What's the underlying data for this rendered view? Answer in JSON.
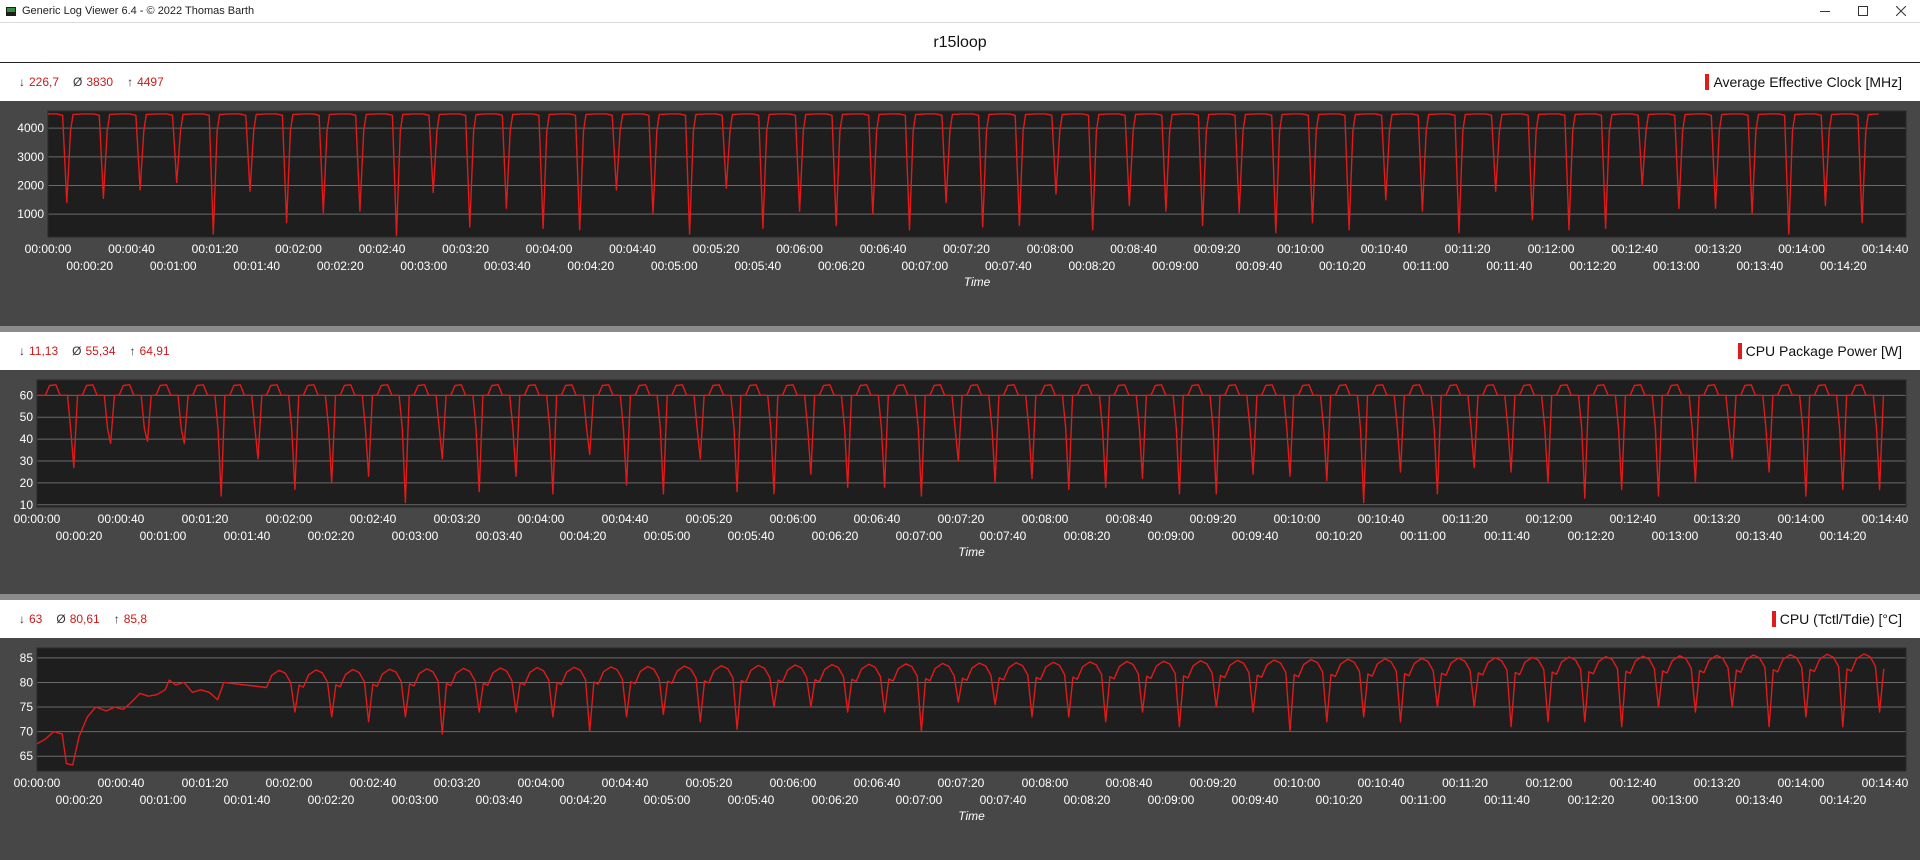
{
  "window": {
    "title": "Generic Log Viewer 6.4 - © 2022 Thomas Barth",
    "icons": [
      "app-icon",
      "minimize-icon",
      "maximize-icon",
      "close-icon"
    ]
  },
  "main_title": "r15loop",
  "colors": {
    "series": "#e11a1a",
    "plot_bg": "#1e1e1e",
    "panel_bg": "#474747",
    "grid": "#6a6a6a",
    "stat_text": "#cc1a1a",
    "axis_text": "#ffffff"
  },
  "time_axis": {
    "label": "Time",
    "top_ticks": [
      "00:00:00",
      "00:00:40",
      "00:01:20",
      "00:02:00",
      "00:02:40",
      "00:03:20",
      "00:04:00",
      "00:04:40",
      "00:05:20",
      "00:06:00",
      "00:06:40",
      "00:07:20",
      "00:08:00",
      "00:08:40",
      "00:09:20",
      "00:10:00",
      "00:10:40",
      "00:11:20",
      "00:12:00",
      "00:12:40",
      "00:13:20",
      "00:14:00",
      "00:14:40"
    ],
    "bottom_ticks": [
      "00:00:20",
      "00:01:00",
      "00:01:40",
      "00:02:20",
      "00:03:00",
      "00:03:40",
      "00:04:20",
      "00:05:00",
      "00:05:40",
      "00:06:20",
      "00:07:00",
      "00:07:40",
      "00:08:20",
      "00:09:00",
      "00:09:40",
      "00:10:20",
      "00:11:00",
      "00:11:40",
      "00:12:20",
      "00:13:00",
      "00:13:40",
      "00:14:20"
    ]
  },
  "panels": [
    {
      "label": "Average Effective Clock [MHz]",
      "stats": {
        "min": "226,7",
        "avg": "3830",
        "max": "4497"
      },
      "stat_symbols": {
        "min": "↓",
        "avg": "Ø",
        "max": "↑"
      }
    },
    {
      "label": "CPU Package Power [W]",
      "stats": {
        "min": "11,13",
        "avg": "55,34",
        "max": "64,91"
      },
      "stat_symbols": {
        "min": "↓",
        "avg": "Ø",
        "max": "↑"
      }
    },
    {
      "label": "CPU (Tctl/Tdie) [°C]",
      "stats": {
        "min": "63",
        "avg": "80,61",
        "max": "85,8"
      },
      "stat_symbols": {
        "min": "↓",
        "avg": "Ø",
        "max": "↑"
      }
    }
  ],
  "chart_data": [
    {
      "type": "line",
      "title": "Average Effective Clock [MHz]",
      "xlabel": "Time",
      "ylabel": "",
      "x_range_seconds": [
        0,
        890
      ],
      "ylim": [
        200,
        4600
      ],
      "yticks": [
        1000,
        2000,
        3000,
        4000
      ],
      "grid": true,
      "cycle_seconds": 17.55,
      "cycles": 50,
      "baseline_value": 4500,
      "dip_minima": [
        1400,
        1550,
        1850,
        2100,
        300,
        1800,
        700,
        1050,
        1100,
        250,
        1750,
        550,
        1200,
        500,
        450,
        1850,
        1000,
        300,
        1900,
        500,
        1100,
        600,
        1000,
        450,
        1400,
        550,
        600,
        1700,
        450,
        1300,
        1100,
        600,
        1050,
        350,
        700,
        450,
        1500,
        1100,
        350,
        1800,
        800,
        450,
        500,
        2000,
        1200,
        1200,
        1000,
        300,
        1300,
        700
      ],
      "series": [
        {
          "name": "Average Effective Clock [MHz]",
          "min": 226.7,
          "avg": 3830,
          "max": 4497
        }
      ]
    },
    {
      "type": "line",
      "title": "CPU Package Power [W]",
      "xlabel": "Time",
      "ylabel": "",
      "x_range_seconds": [
        0,
        890
      ],
      "ylim": [
        9,
        67
      ],
      "yticks": [
        10,
        20,
        30,
        40,
        50,
        60
      ],
      "grid": true,
      "cycle_seconds": 17.55,
      "cycles": 50,
      "baseline_value": 60,
      "peak_value": 64.9,
      "dip_minima": [
        27,
        38,
        39,
        38,
        14,
        31,
        17,
        20,
        23,
        11,
        31,
        16,
        23,
        15,
        33,
        19,
        15,
        31,
        16,
        15,
        24,
        18,
        18,
        14,
        30,
        20,
        22,
        17,
        18,
        22,
        15,
        15,
        24,
        23,
        21,
        11,
        25,
        15,
        27,
        25,
        20,
        13,
        17,
        14,
        20,
        31,
        25,
        14,
        17,
        17
      ],
      "series": [
        {
          "name": "CPU Package Power [W]",
          "min": 11.13,
          "avg": 55.34,
          "max": 64.91
        }
      ]
    },
    {
      "type": "line",
      "title": "CPU (Tctl/Tdie) [°C]",
      "xlabel": "Time",
      "ylabel": "",
      "x_range_seconds": [
        0,
        890
      ],
      "ylim": [
        62,
        87
      ],
      "yticks": [
        65,
        70,
        75,
        80,
        85
      ],
      "grid": true,
      "cycle_seconds": 17.55,
      "cycles": 50,
      "start_value": 67.5,
      "warmup_points": [
        [
          0,
          67.5
        ],
        [
          4,
          68.5
        ],
        [
          8,
          70
        ],
        [
          12,
          69.5
        ],
        [
          14,
          63.5
        ],
        [
          17,
          63.2
        ],
        [
          20,
          69
        ],
        [
          24,
          73
        ],
        [
          28,
          75
        ],
        [
          33,
          74.2
        ],
        [
          37,
          75
        ],
        [
          41,
          74.5
        ],
        [
          45,
          76
        ],
        [
          49,
          77.8
        ],
        [
          53,
          77.2
        ],
        [
          57,
          77.5
        ],
        [
          61,
          78.5
        ],
        [
          63,
          80.5
        ],
        [
          66,
          79.5
        ],
        [
          70,
          80
        ],
        [
          74,
          78
        ],
        [
          78,
          78.5
        ],
        [
          82,
          78
        ],
        [
          86,
          76.5
        ],
        [
          89,
          80
        ]
      ],
      "peak_start": 82.0,
      "peak_end": 85.8,
      "dip_minima": [
        68.5,
        71.5,
        72,
        72,
        73,
        68.5,
        74,
        73,
        72,
        73,
        69.5,
        74,
        74,
        73,
        70,
        73,
        73.5,
        72,
        70.5,
        75,
        75,
        74,
        74,
        70,
        76,
        75.5,
        73,
        73,
        72,
        74,
        71,
        75,
        74,
        70,
        72,
        73,
        72,
        75,
        75,
        71,
        72,
        72,
        71,
        75,
        74,
        75,
        71,
        73,
        71,
        74
      ],
      "series": [
        {
          "name": "CPU (Tctl/Tdie) [°C]",
          "min": 63,
          "avg": 80.61,
          "max": 85.8
        }
      ]
    }
  ]
}
